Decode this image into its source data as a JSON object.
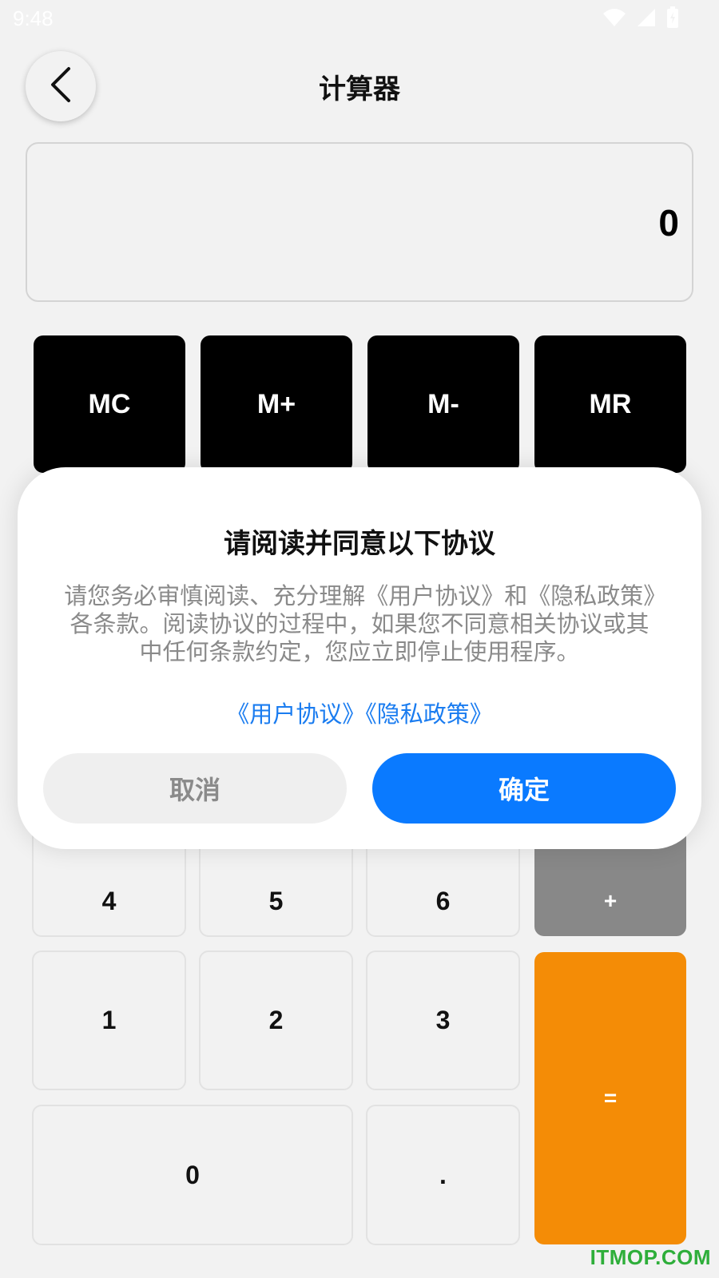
{
  "status_bar": {
    "time": "9:48",
    "icons": [
      "wifi-icon",
      "cell-signal-icon",
      "battery-icon"
    ]
  },
  "header": {
    "title": "计算器",
    "back_icon": "chevron-left-icon"
  },
  "display": {
    "value": "0"
  },
  "memory_keys": [
    "MC",
    "M+",
    "M-",
    "MR"
  ],
  "keypad": {
    "row_456": [
      "4",
      "5",
      "6"
    ],
    "plus": "+",
    "row_123": [
      "1",
      "2",
      "3"
    ],
    "zero": "0",
    "dot": ".",
    "equals": "="
  },
  "dialog": {
    "title": "请阅读并同意以下协议",
    "body": "请您务必审慎阅读、充分理解《用户协议》和《隐私政策》各条款。阅读协议的过程中，如果您不同意相关协议或其中任何条款约定，您应立即停止使用程序。",
    "link_user_agreement": "《用户协议》",
    "link_privacy_policy": "《隐私政策》",
    "cancel_label": "取消",
    "confirm_label": "确定"
  },
  "colors": {
    "background": "#f2f2f2",
    "memory_key": "#000000",
    "plus_key": "#888888",
    "equals_key": "#f48c06",
    "confirm_button": "#0a7aff",
    "link": "#1a7cf0"
  },
  "watermark": "ITMOP.COM"
}
